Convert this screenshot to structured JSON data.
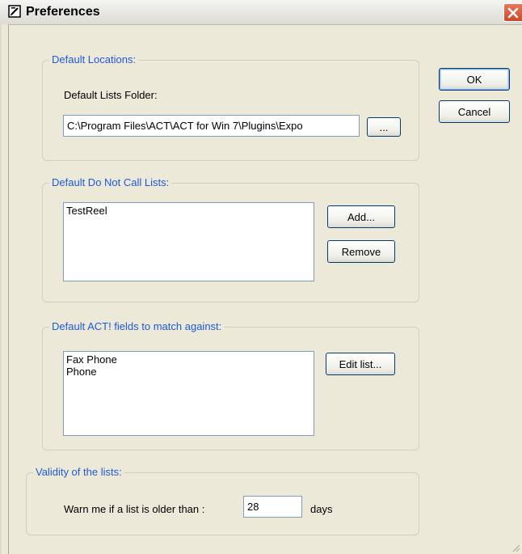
{
  "window": {
    "title": "Preferences",
    "app_icon": "document-edit-icon",
    "close_icon": "close-icon"
  },
  "default_locations": {
    "legend": "Default Locations:",
    "folder_label": "Default Lists Folder:",
    "folder_value": "C:\\Program Files\\ACT\\ACT for Win 7\\Plugins\\Expo",
    "browse_label": "..."
  },
  "do_not_call": {
    "legend": "Default Do Not Call Lists:",
    "items": [
      "TestReel"
    ],
    "add_label": "Add...",
    "remove_label": "Remove"
  },
  "fields_match": {
    "legend": "Default ACT! fields to match against:",
    "items": [
      "Fax Phone",
      "Phone"
    ],
    "edit_label": "Edit list..."
  },
  "validity": {
    "legend": "Validity of the lists:",
    "warn_label": "Warn me if a list is older than :",
    "days_value": "28",
    "days_unit": "days"
  },
  "buttons": {
    "ok_label": "OK",
    "cancel_label": "Cancel"
  },
  "colors": {
    "legend": "#1d5ad8",
    "dialog_bg": "#ece9d8",
    "close_red": "#d2563a"
  }
}
